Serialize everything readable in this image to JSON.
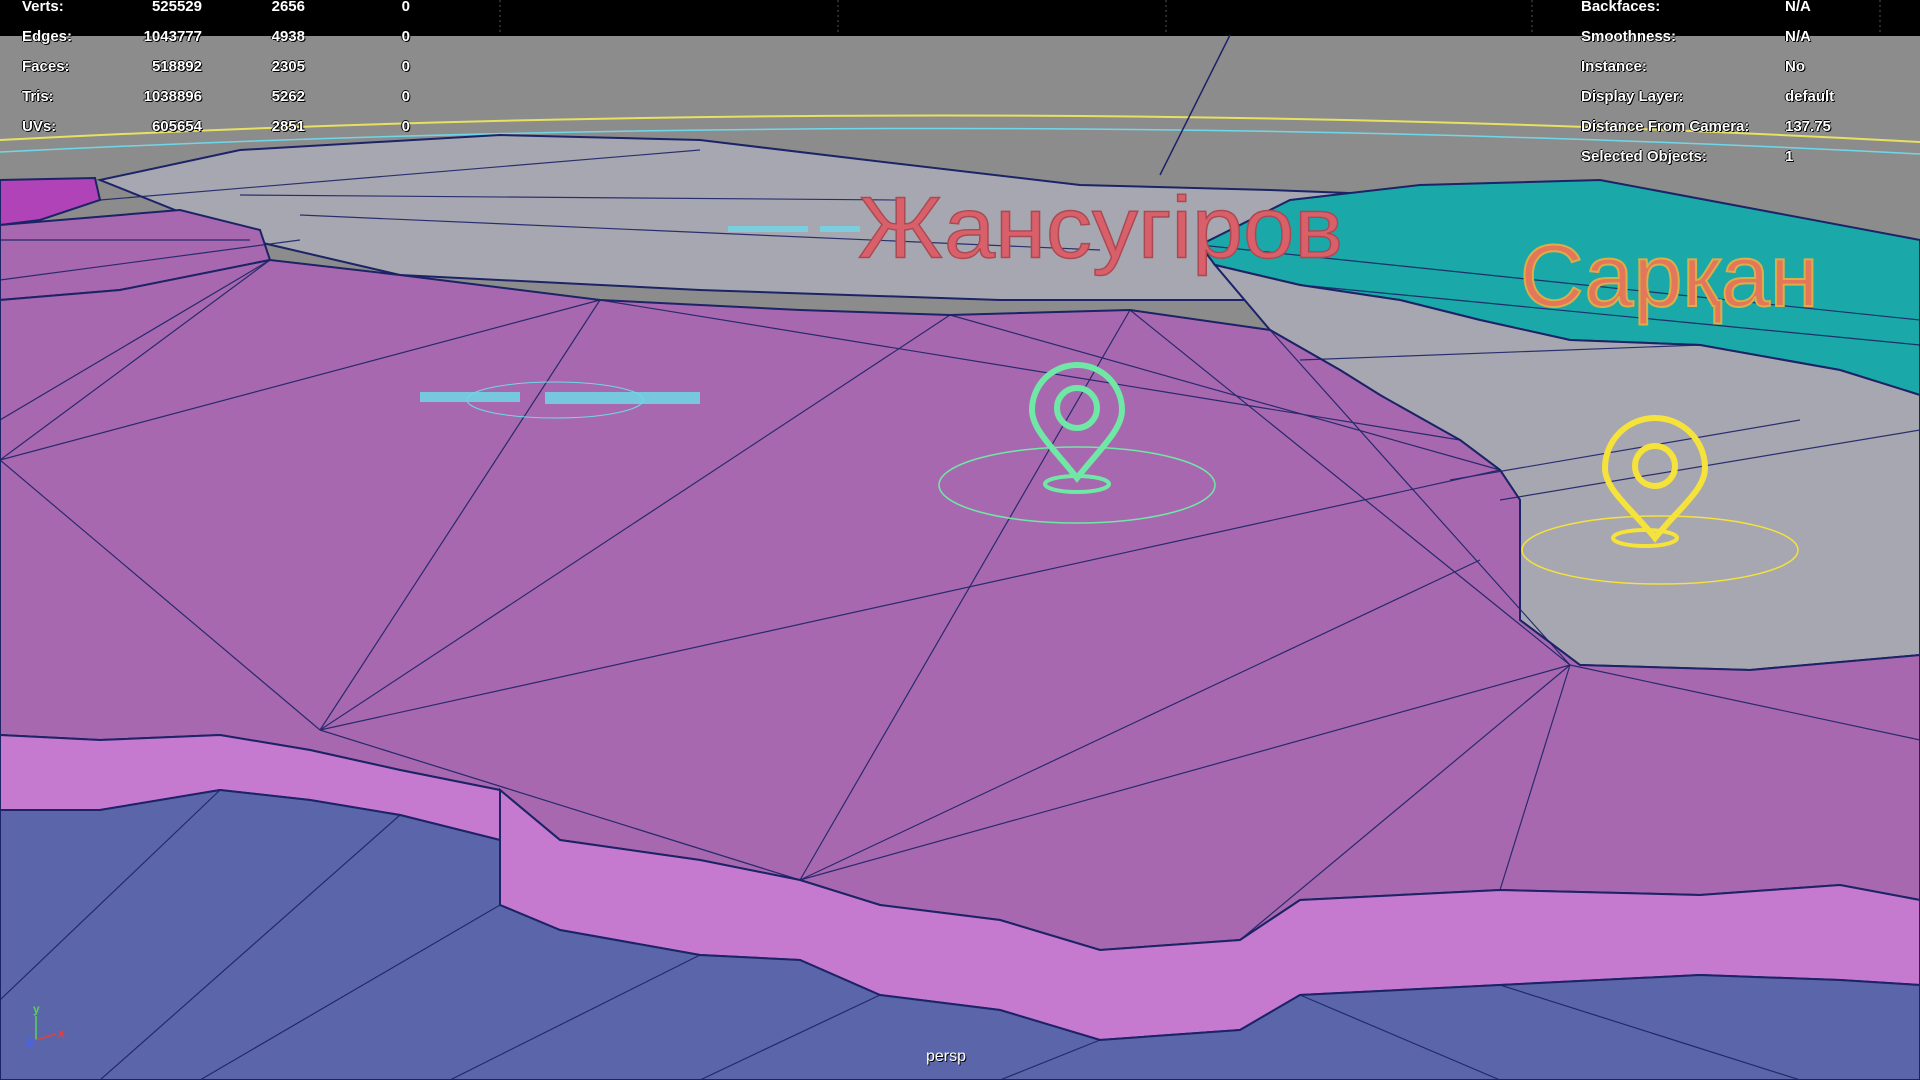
{
  "hud": {
    "stats": [
      {
        "label": "Verts:",
        "v1": "525529",
        "v2": "2656",
        "v3": "0"
      },
      {
        "label": "Edges:",
        "v1": "1043777",
        "v2": "4938",
        "v3": "0"
      },
      {
        "label": "Faces:",
        "v1": "518892",
        "v2": "2305",
        "v3": "0"
      },
      {
        "label": "Tris:",
        "v1": "1038896",
        "v2": "5262",
        "v3": "0"
      },
      {
        "label": "UVs:",
        "v1": "605654",
        "v2": "2851",
        "v3": "0"
      }
    ],
    "info": [
      {
        "label": "Backfaces:",
        "value": "N/A"
      },
      {
        "label": "Smoothness:",
        "value": "N/A"
      },
      {
        "label": "Instance:",
        "value": "No"
      },
      {
        "label": "Display Layer:",
        "value": "default"
      },
      {
        "label": "Distance From Camera:",
        "value": "137.75"
      },
      {
        "label": "Selected Objects:",
        "value": "1"
      }
    ]
  },
  "map": {
    "city_labels": {
      "zhansugirov": "Жансугіров",
      "sarkan": "Сарқан"
    },
    "pins": {
      "selected_color": "#6fe8a6",
      "other_color": "#f5e23a"
    }
  },
  "viewport": {
    "camera": "persp",
    "axis": {
      "y": "y",
      "x": "x",
      "z": "z"
    }
  },
  "colors": {
    "background": "#8c8c8c",
    "region_main": "#a868b0",
    "region_side": "#c57ad0",
    "region_teal": "#1aa8a8",
    "region_grey": "#a7a7b1",
    "ground_blue": "#5b66aa",
    "wire": "#1c2366"
  }
}
